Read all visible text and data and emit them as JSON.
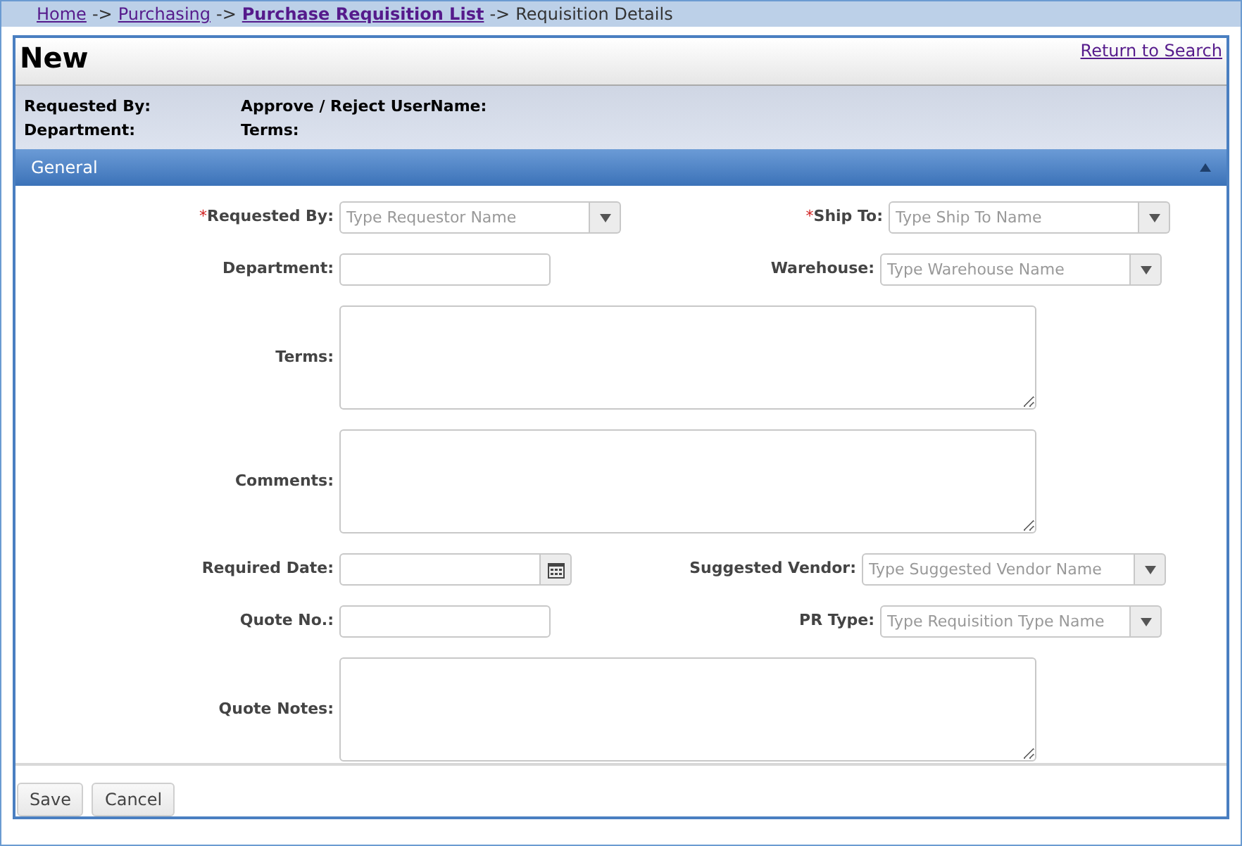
{
  "breadcrumb": [
    {
      "label": "Home",
      "kind": "link",
      "bold": false
    },
    {
      "label": "Purchasing",
      "kind": "link",
      "bold": false
    },
    {
      "label": "Purchase Requisition List",
      "kind": "link",
      "bold": true
    },
    {
      "label": "Requisition Details",
      "kind": "text",
      "bold": false
    }
  ],
  "breadcrumb_separator": "->",
  "title": "New",
  "return_link": "Return to Search",
  "summary": [
    [
      "Requested By:",
      "Approve / Reject UserName:"
    ],
    [
      "Department:",
      "Terms:"
    ]
  ],
  "section": {
    "title": "General",
    "expanded": true
  },
  "form_rows": [
    {
      "left": {
        "label": "Requested By:",
        "kind": "combo",
        "placeholder": "Type Requestor Name",
        "required": true
      },
      "right": {
        "label": "Ship To:",
        "kind": "combo",
        "placeholder": "Type Ship To Name",
        "required": true
      }
    },
    {
      "left": {
        "label": "Department:",
        "kind": "text",
        "required": false
      },
      "right": {
        "label": "Warehouse:",
        "kind": "combo",
        "placeholder": "Type Warehouse Name",
        "required": false
      }
    },
    {
      "left": {
        "label": "Terms:",
        "kind": "textarea",
        "required": false
      }
    },
    {
      "left": {
        "label": "Comments:",
        "kind": "textarea",
        "required": false
      }
    },
    {
      "left": {
        "label": "Required Date:",
        "kind": "date",
        "required": false
      },
      "right": {
        "label": "Suggested Vendor:",
        "kind": "combo",
        "placeholder": "Type Suggested Vendor Name",
        "required": false
      }
    },
    {
      "left": {
        "label": "Quote No.:",
        "kind": "text",
        "required": false
      },
      "right": {
        "label": "PR Type:",
        "kind": "combo",
        "placeholder": "Type Requisition Type Name",
        "required": false
      }
    },
    {
      "left": {
        "label": "Quote Notes:",
        "kind": "textarea",
        "required": false
      }
    }
  ],
  "required_mark": "*",
  "buttons": [
    "Save",
    "Cancel"
  ]
}
